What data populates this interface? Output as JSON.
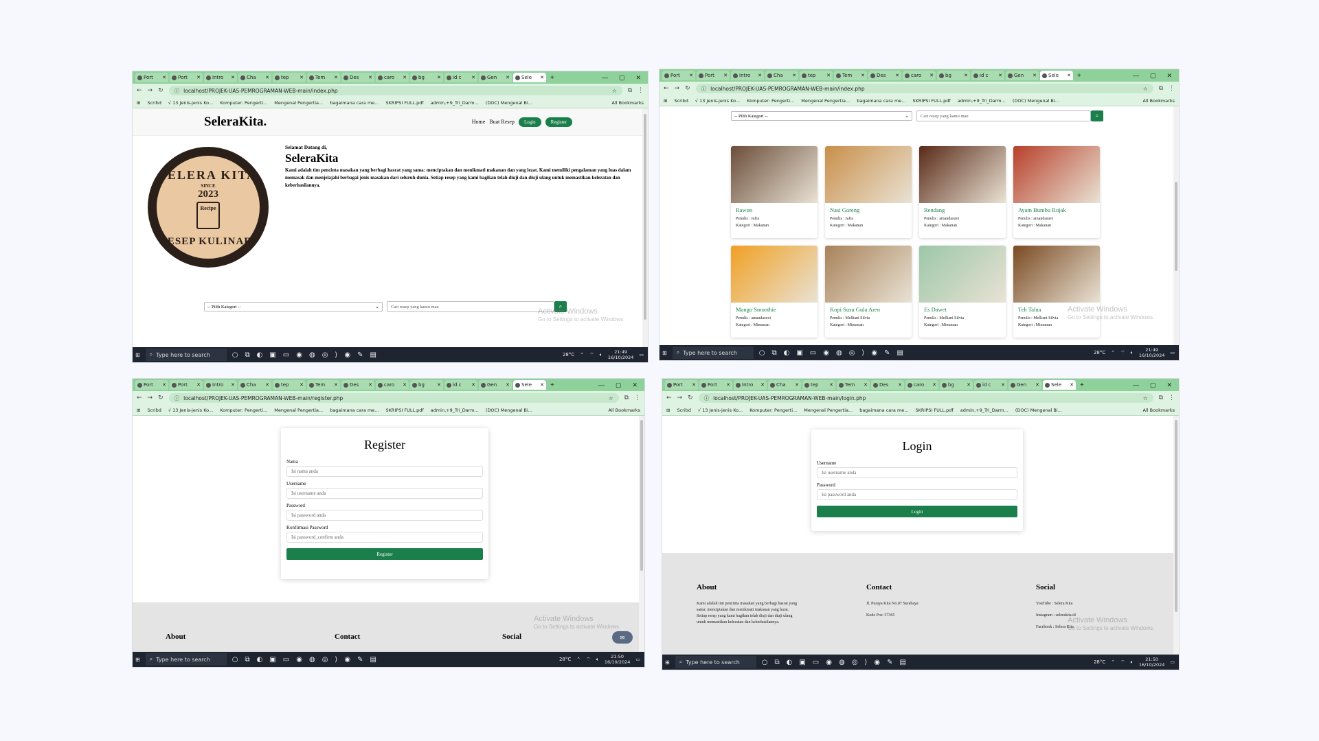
{
  "tabs": [
    {
      "label": "Port"
    },
    {
      "label": "Port"
    },
    {
      "label": "Intro"
    },
    {
      "label": "Cha"
    },
    {
      "label": "tep"
    },
    {
      "label": "Tem"
    },
    {
      "label": "Des"
    },
    {
      "label": "caro"
    },
    {
      "label": "bg"
    },
    {
      "label": "id c"
    },
    {
      "label": "Gen"
    },
    {
      "label": "Sele",
      "active": true
    }
  ],
  "bookmarks": [
    "Scribd",
    "√ 13 Jenis-jenis Ko...",
    "Komputer: Pengerti...",
    "Mengenal Pengertia...",
    "bagaimana cara me...",
    "SKRIPSI FULL.pdf",
    "admin,+9_Tri_Darm...",
    "(DOC) Mengenal Bi..."
  ],
  "all_bookmarks": "All Bookmarks",
  "taskbar": {
    "search_placeholder": "Type here to search",
    "temp": "28°C",
    "windows": [
      {
        "time": "21:49",
        "date": "16/10/2024"
      },
      {
        "time": "21:49",
        "date": "16/10/2024"
      },
      {
        "time": "21:50",
        "date": "16/10/2024"
      },
      {
        "time": "21:50",
        "date": "16/10/2024"
      }
    ]
  },
  "activate": {
    "title": "Activate Windows",
    "subtitle": "Go to Settings to activate Windows."
  },
  "urls": {
    "index": "localhost/PROJEK-UAS-PEMROGRAMAN-WEB-main/index.php",
    "register": "localhost/PROJEK-UAS-PEMROGRAMAN-WEB-main/register.php",
    "login": "localhost/PROJEK-UAS-PEMROGRAMAN-WEB-main/login.php"
  },
  "site": {
    "brand": "SeleraKita.",
    "nav": {
      "home": "Home",
      "buat_resep": "Buat Resep",
      "login": "Login",
      "register": "Register"
    },
    "logo": {
      "top": "SELERA KITA",
      "since": "SINCE",
      "year": "2023",
      "recipe": "Recipe",
      "bottom": "RESEP KULINARI"
    },
    "welcome_small": "Selamat Datang di,",
    "welcome_title": "SeleraKita",
    "welcome_text": "Kami adalah tim pencinta masakan yang berbagi hasrat yang sama: menciptakan dan menikmati makanan dan yang lezat. Kami memiliki pengalaman yang luas dalam memasak dan menjelajahi berbagai jenis masakan dari seluruh dunia. Setiap resep yang kami bagikan telah diuji dan diuji ulang untuk memastikan kelezatan dan keberhasilannya.",
    "category_placeholder": "-- Pilih Kategori --",
    "search_placeholder": "Cari resep yang kamu mau"
  },
  "recipes": [
    {
      "name": "Rawon",
      "author": "Penulis : Jafra",
      "category": "Kategori : Makanan",
      "color": "#6b4e3a"
    },
    {
      "name": "Nasi Goreng",
      "author": "Penulis : Jafra",
      "category": "Kategori : Makanan",
      "color": "#c98f4a"
    },
    {
      "name": "Rendang",
      "author": "Penulis : amandasuvi",
      "category": "Kategori : Makanan",
      "color": "#5a2a18"
    },
    {
      "name": "Ayam Bumbu Rujak",
      "author": "Penulis : amandasuvi",
      "category": "Kategori : Makanan",
      "color": "#b8402a"
    },
    {
      "name": "Mango Smoothie",
      "author": "Penulis : amandasuvi",
      "category": "Kategori : Minuman",
      "color": "#f0a023"
    },
    {
      "name": "Kopi Susu Gula Aren",
      "author": "Penulis : Melliani Silvia",
      "category": "Kategori : Minuman",
      "color": "#a8825a"
    },
    {
      "name": "Es Dawet",
      "author": "Penulis : Melliani Silvia",
      "category": "Kategori : Minuman",
      "color": "#9cc7a8"
    },
    {
      "name": "Teh Talua",
      "author": "Penulis : Melliani Silvia",
      "category": "Kategori : Minuman",
      "color": "#7a4a22"
    }
  ],
  "register": {
    "title": "Register",
    "nama_label": "Nama",
    "nama_placeholder": "Isi nama anda",
    "username_label": "Username",
    "username_placeholder": "Isi username anda",
    "password_label": "Password",
    "password_placeholder": "Isi password anda",
    "confirm_label": "Konfirmasi Password",
    "confirm_placeholder": "Isi password_confirm anda",
    "button": "Register"
  },
  "login": {
    "title": "Login",
    "username_label": "Username",
    "username_placeholder": "Isi username anda",
    "password_label": "Password",
    "password_placeholder": "Isi password anda",
    "button": "Login"
  },
  "footer": {
    "about_title": "About",
    "about_text": "Kami adalah tim pencinta masakan yang berbagi hasrat yang sama: menciptakan dan menikmati makanan yang lezat. Setiap resep yang kami bagikan telah diuji dan diuji ulang untuk memastikan kelezatan dan keberhasilannya.",
    "contact_title": "Contact",
    "address": "Jl. Puraya Kita No.07 Surabaya",
    "postal": "Kode Pos: 57365",
    "social_title": "Social",
    "youtube": "YouTube : Selera Kita",
    "instagram": "Instagram : selerakita.id",
    "facebook": "Facebook : Selera Kita"
  },
  "colors": {
    "accent": "#1a7f4b",
    "chrome": "#8fd19a"
  }
}
